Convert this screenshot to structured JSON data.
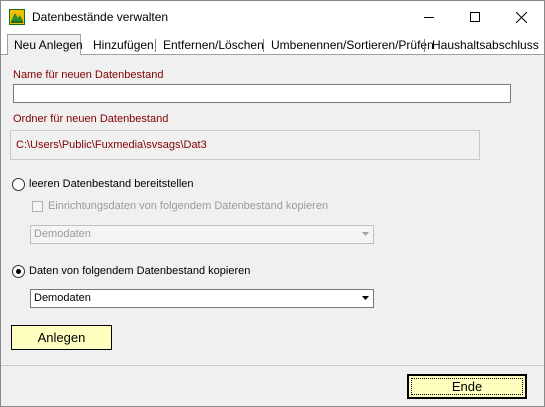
{
  "window": {
    "title": "Datenbestände verwalten",
    "icon": "fuxmedia-app-icon",
    "controls": {
      "minimize": "minimize-icon",
      "maximize": "maximize-icon",
      "close": "close-icon"
    }
  },
  "tabs": [
    {
      "label": "Neu Anlegen",
      "active": true
    },
    {
      "label": "Hinzufügen",
      "active": false
    },
    {
      "label": "Entfernen/Löschen",
      "active": false
    },
    {
      "label": "Umbenennen/Sortieren/Prüfen",
      "active": false
    },
    {
      "label": "Haushaltsabschluss",
      "active": false
    }
  ],
  "form": {
    "name_label": "Name für neuen Datenbestand",
    "name_value": "",
    "folder_label": "Ordner für neuen Datenbestand",
    "folder_value": "C:\\Users\\Public\\Fuxmedia\\svsags\\Dat3",
    "radio_empty_label": "leeren Datenbestand bereitstellen",
    "radio_empty_selected": false,
    "checkbox_copy_setup_label": "Einrichtungsdaten von folgendem Datenbestand kopieren",
    "checkbox_copy_setup_checked": false,
    "combo_setup_value": "Demodaten",
    "radio_copy_label": "Daten von folgendem Datenbestand kopieren",
    "radio_copy_selected": true,
    "combo_copy_value": "Demodaten"
  },
  "buttons": {
    "create_label": "Anlegen",
    "end_label": "Ende"
  },
  "colors": {
    "label_red": "#800000",
    "button_yellow": "#ffffc0",
    "panel_bg": "#f0f0f0"
  }
}
